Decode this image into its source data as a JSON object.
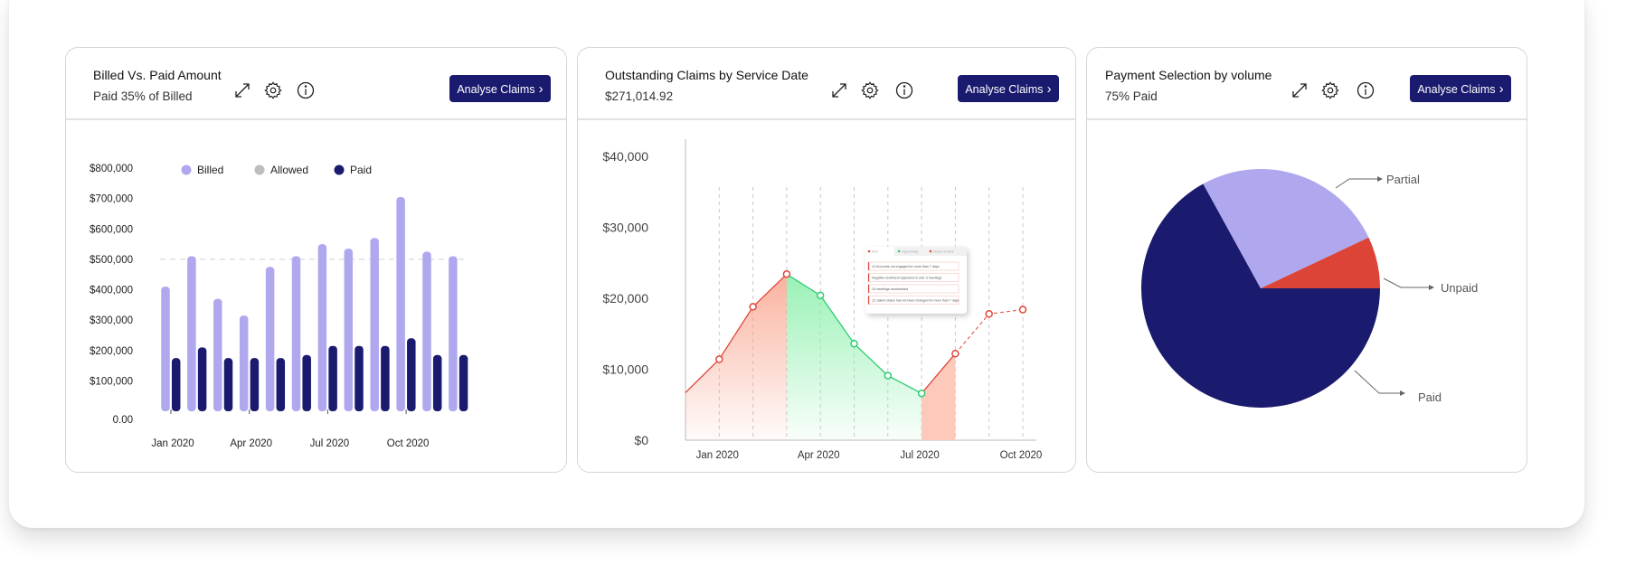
{
  "colors": {
    "billed": "#b0a8ee",
    "allowed": "#bdbdbd",
    "paid": "#1a1a6e",
    "button": "#1a1a6e",
    "risk": "#e0473a",
    "opportunity": "#2ecc71",
    "unpaid": "#db4437"
  },
  "cards": [
    {
      "title": "Billed Vs. Paid Amount",
      "subtitle": "Paid 35% of Billed",
      "button": "Analyse Claims",
      "icons": [
        "expand-icon",
        "gear-icon",
        "info-icon"
      ]
    },
    {
      "title": "Outstanding Claims by Service Date",
      "subtitle": "$271,014.92",
      "button": "Analyse Claims",
      "icons": [
        "expand-icon",
        "gear-icon",
        "info-icon"
      ]
    },
    {
      "title": "Payment Selection by volume",
      "subtitle": "75% Paid",
      "button": "Analyse Claims",
      "icons": [
        "expand-icon",
        "gear-icon",
        "info-icon"
      ]
    }
  ],
  "chart_data": [
    {
      "type": "bar",
      "ylim": [
        0,
        800000
      ],
      "yticks": [
        0,
        100000,
        200000,
        300000,
        400000,
        500000,
        600000,
        700000,
        800000
      ],
      "ytick_labels": [
        "0.00",
        "$100,000",
        "$200,000",
        "$300,000",
        "$400,000",
        "$500,000",
        "$600,000",
        "$700,000",
        "$800,000"
      ],
      "xtick_labels": [
        {
          "index": 0,
          "label": "Jan 2020"
        },
        {
          "index": 3,
          "label": "Apr 2020"
        },
        {
          "index": 6,
          "label": "Jul 2020"
        },
        {
          "index": 9,
          "label": "Oct 2020"
        }
      ],
      "reference_line": 500000,
      "legend": "top",
      "series": [
        {
          "name": "Billed",
          "values": [
            410000,
            510000,
            370000,
            315000,
            475000,
            510000,
            550000,
            535000,
            570000,
            705000,
            525000,
            510000
          ]
        },
        {
          "name": "Allowed",
          "values": []
        },
        {
          "name": "Paid",
          "values": [
            175000,
            210000,
            175000,
            175000,
            175000,
            185000,
            215000,
            215000,
            215000,
            240000,
            185000,
            185000
          ]
        }
      ]
    },
    {
      "type": "area",
      "ylim": [
        0,
        40000
      ],
      "yticks": [
        0,
        10000,
        20000,
        30000,
        40000
      ],
      "ytick_labels": [
        "$0",
        "$10,000",
        "$20,000",
        "$30,000",
        "$40,000"
      ],
      "x": [
        "Dec 2019",
        "Jan 2020",
        "Feb 2020",
        "Mar 2020",
        "Apr 2020",
        "May 2020",
        "Jun 2020",
        "Jul 2020",
        "Aug 2020",
        "Sep 2020",
        "Oct 2020"
      ],
      "xtick_labels": [
        {
          "index": 1,
          "label": "Jan 2020"
        },
        {
          "index": 4,
          "label": "Apr 2020"
        },
        {
          "index": 7,
          "label": "Jul 2020"
        },
        {
          "index": 10,
          "label": "Oct 2020"
        }
      ],
      "values": [
        6700,
        11400,
        18800,
        23400,
        20400,
        13600,
        9100,
        6600,
        12200,
        17800,
        18400
      ],
      "segments": [
        {
          "from": 0,
          "to": 3,
          "status": "risk",
          "style": "solid"
        },
        {
          "from": 3,
          "to": 7,
          "status": "opportunity",
          "style": "solid"
        },
        {
          "from": 7,
          "to": 8,
          "status": "risk",
          "style": "solid"
        },
        {
          "from": 8,
          "to": 10,
          "status": "risk",
          "style": "dashed"
        }
      ],
      "grid": "vertical-dashed",
      "tooltip": {
        "legend": [
          "Risk",
          "Opportunity",
          "Closed at Risk"
        ],
        "items": [
          "12 Accounts not engaged for more than 7 days",
          "Negative sentiment appeared in over 3 meetings",
          "15 meetings rescheduled",
          "12 claims status has not been changed for more than 7 days"
        ]
      }
    },
    {
      "type": "pie",
      "slices": [
        {
          "label": "Paid",
          "value": 67
        },
        {
          "label": "Partial",
          "value": 26
        },
        {
          "label": "Unpaid",
          "value": 7
        }
      ]
    }
  ]
}
